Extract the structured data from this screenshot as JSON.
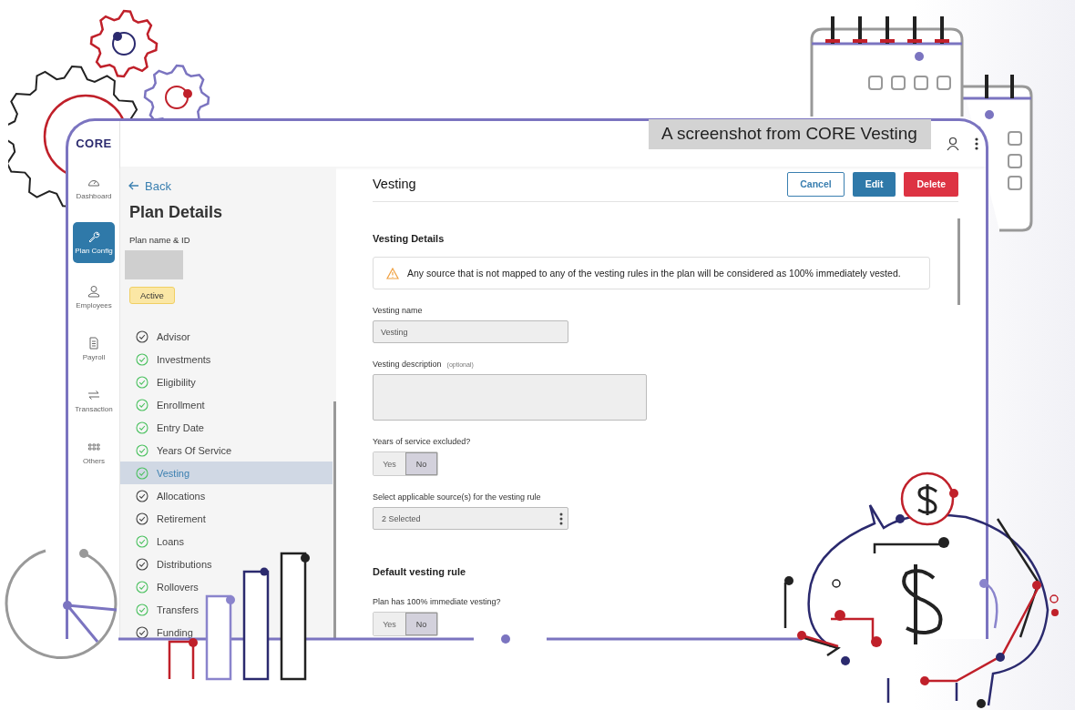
{
  "caption": "A screenshot from CORE Vesting",
  "logo": "CORE",
  "rail": [
    {
      "label": "Dashboard",
      "selected": false
    },
    {
      "label": "Plan Config",
      "selected": true
    },
    {
      "label": "Employees",
      "selected": false
    },
    {
      "label": "Payroll",
      "selected": false
    },
    {
      "label": "Transaction",
      "selected": false
    },
    {
      "label": "Others",
      "selected": false
    }
  ],
  "sidebar": {
    "back": "Back",
    "title": "Plan Details",
    "plan_label": "Plan name & ID",
    "status": "Active",
    "steps": [
      {
        "label": "Advisor",
        "complete": false,
        "selected": false
      },
      {
        "label": "Investments",
        "complete": true,
        "selected": false
      },
      {
        "label": "Eligibility",
        "complete": true,
        "selected": false
      },
      {
        "label": "Enrollment",
        "complete": true,
        "selected": false
      },
      {
        "label": "Entry Date",
        "complete": true,
        "selected": false
      },
      {
        "label": "Years Of Service",
        "complete": true,
        "selected": false
      },
      {
        "label": "Vesting",
        "complete": true,
        "selected": true
      },
      {
        "label": "Allocations",
        "complete": false,
        "selected": false
      },
      {
        "label": "Retirement",
        "complete": false,
        "selected": false
      },
      {
        "label": "Loans",
        "complete": true,
        "selected": false
      },
      {
        "label": "Distributions",
        "complete": false,
        "selected": false
      },
      {
        "label": "Rollovers",
        "complete": true,
        "selected": false
      },
      {
        "label": "Transfers",
        "complete": true,
        "selected": false
      },
      {
        "label": "Funding",
        "complete": false,
        "selected": false
      }
    ]
  },
  "main": {
    "title": "Vesting",
    "buttons": [
      {
        "label": "Cancel",
        "kind": "outline"
      },
      {
        "label": "Edit",
        "kind": "primary"
      },
      {
        "label": "Delete",
        "kind": "danger"
      }
    ],
    "section": "Vesting Details",
    "alert": "Any source that is not mapped to any of the vesting rules in the plan will be considered as 100% immediately vested.",
    "fields": [
      {
        "kind": "text",
        "label": "Vesting name",
        "value": "Vesting"
      },
      {
        "kind": "textarea",
        "label": "Vesting description",
        "hint": "(optional)"
      },
      {
        "kind": "toggle",
        "label": "Years of service excluded?",
        "options": [
          {
            "label": "Yes",
            "selected": false
          },
          {
            "label": "No",
            "selected": true
          }
        ]
      },
      {
        "kind": "select",
        "label": "Select applicable source(s) for the vesting rule",
        "value": "2 Selected"
      },
      {
        "kind": "heading",
        "label": "Default vesting rule"
      },
      {
        "kind": "toggle",
        "label": "Plan has 100% immediate vesting?",
        "options": [
          {
            "label": "Yes",
            "selected": false
          },
          {
            "label": "No",
            "selected": true
          }
        ]
      }
    ]
  }
}
